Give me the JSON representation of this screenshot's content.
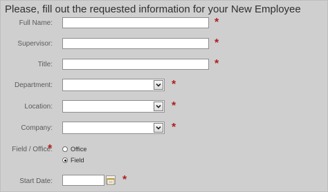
{
  "form": {
    "heading": "Please, fill out the requested information for your New Employee",
    "required_marker": "*",
    "fields": {
      "full_name": {
        "label": "Full Name:",
        "value": ""
      },
      "supervisor": {
        "label": "Supervisor:",
        "value": ""
      },
      "title": {
        "label": "Title:",
        "value": ""
      },
      "department": {
        "label": "Department:",
        "value": ""
      },
      "location": {
        "label": "Location:",
        "value": ""
      },
      "company": {
        "label": "Company:",
        "value": ""
      },
      "field_office": {
        "label": "Field / Office:",
        "options": [
          "Office",
          "Field"
        ],
        "selected": "Field"
      },
      "start_date": {
        "label": "Start Date:",
        "value": ""
      }
    },
    "colors": {
      "required": "#b01e1e",
      "panel_bg": "#cfcfcf"
    },
    "icons": {
      "select_arrow": "chevron-down-icon",
      "calendar": "calendar-icon"
    }
  }
}
